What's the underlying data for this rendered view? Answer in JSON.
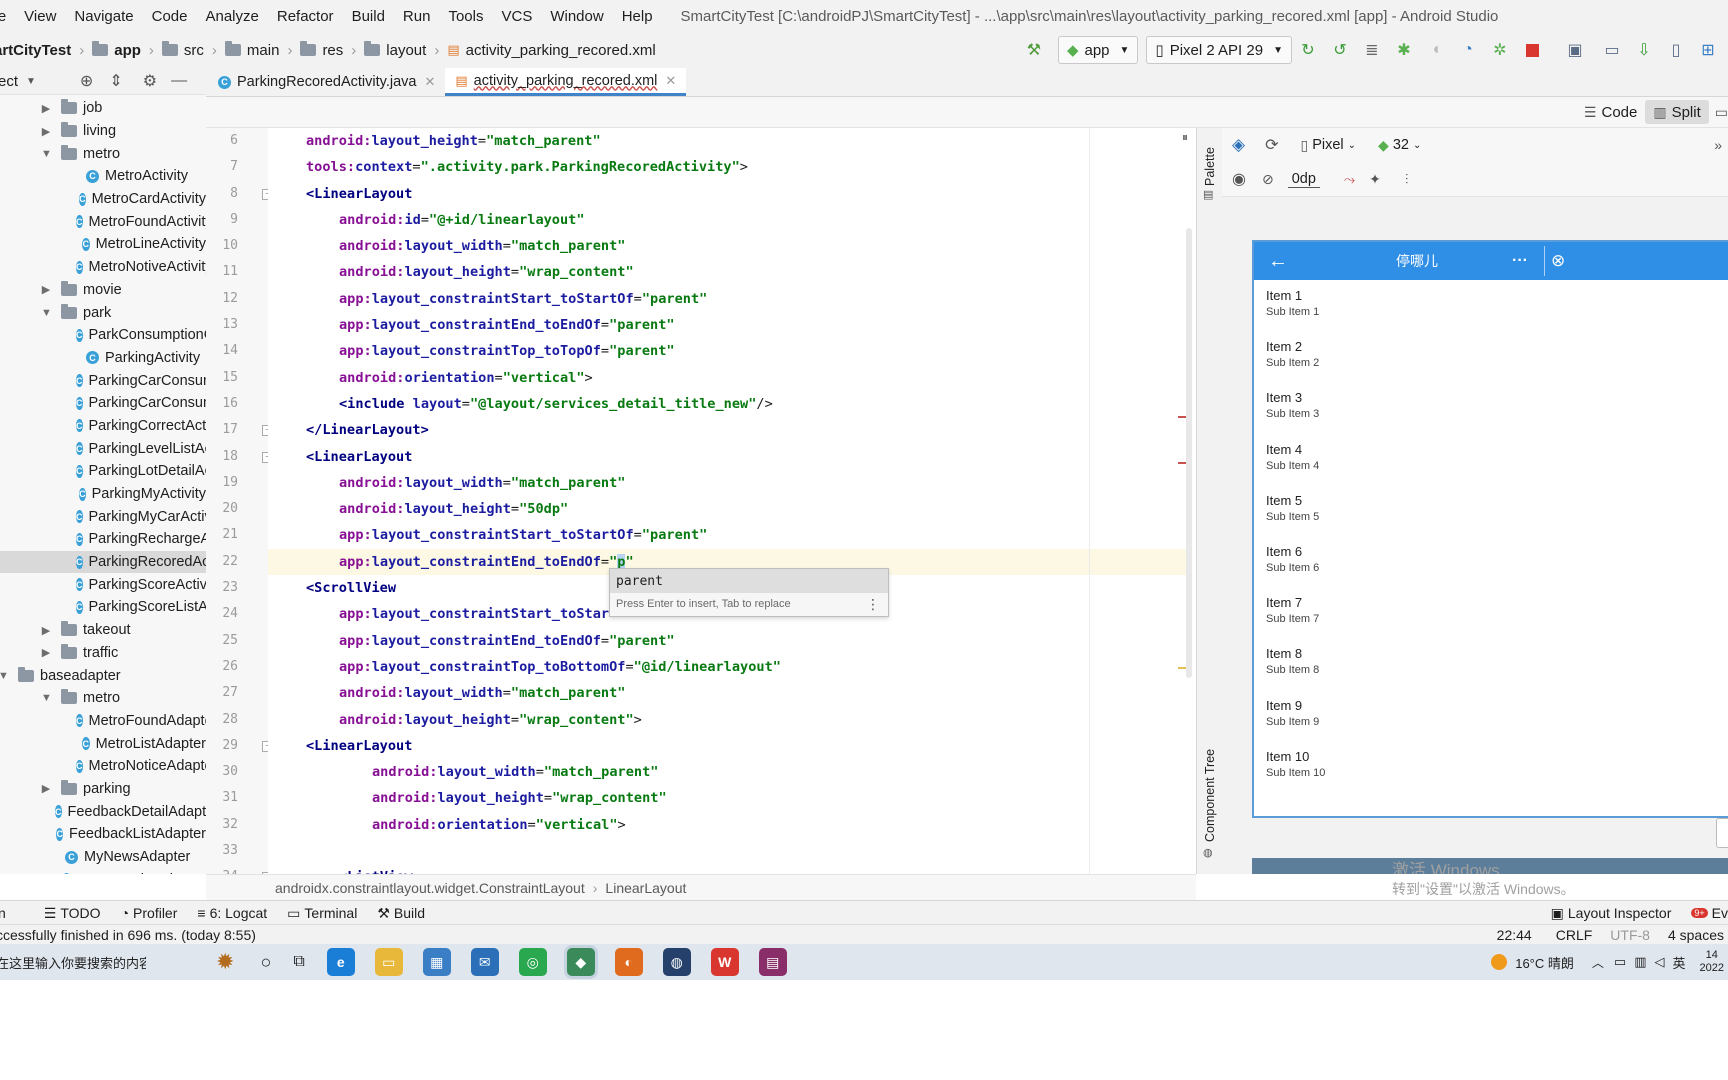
{
  "menubar": {
    "items": [
      "File",
      "View",
      "Navigate",
      "Code",
      "Analyze",
      "Refactor",
      "Build",
      "Run",
      "Tools",
      "VCS",
      "Window",
      "Help"
    ],
    "window_title": "SmartCityTest [C:\\androidPJ\\SmartCityTest] - ...\\app\\src\\main\\res\\layout\\activity_parking_recored.xml [app] - Android Studio"
  },
  "navbar": {
    "crumbs": [
      "artCityTest",
      "app",
      "src",
      "main",
      "res",
      "layout",
      "activity_parking_recored.xml"
    ],
    "run_config": "app",
    "device": "Pixel 2 API 29"
  },
  "project": {
    "header": "ect",
    "rows": [
      {
        "label": "job",
        "kind": "folder",
        "indent": 1,
        "arrow": "right"
      },
      {
        "label": "living",
        "kind": "folder",
        "indent": 1,
        "arrow": "right"
      },
      {
        "label": "metro",
        "kind": "folder",
        "indent": 1,
        "arrow": "down"
      },
      {
        "label": "MetroActivity",
        "kind": "class",
        "indent": 2
      },
      {
        "label": "MetroCardActivity",
        "kind": "class",
        "indent": 2
      },
      {
        "label": "MetroFoundActivity",
        "kind": "class",
        "indent": 2
      },
      {
        "label": "MetroLineActivity",
        "kind": "class",
        "indent": 2
      },
      {
        "label": "MetroNotiveActivity",
        "kind": "class",
        "indent": 2
      },
      {
        "label": "movie",
        "kind": "folder",
        "indent": 1,
        "arrow": "right"
      },
      {
        "label": "park",
        "kind": "folder",
        "indent": 1,
        "arrow": "down"
      },
      {
        "label": "ParkConsumptionCl",
        "kind": "class",
        "indent": 2
      },
      {
        "label": "ParkingActivity",
        "kind": "class",
        "indent": 2
      },
      {
        "label": "ParkingCarConsump",
        "kind": "class",
        "indent": 2
      },
      {
        "label": "ParkingCarConsump",
        "kind": "class",
        "indent": 2
      },
      {
        "label": "ParkingCorrectActiv",
        "kind": "class",
        "indent": 2
      },
      {
        "label": "ParkingLevelListActi",
        "kind": "class",
        "indent": 2
      },
      {
        "label": "ParkingLotDetailAct",
        "kind": "class",
        "indent": 2
      },
      {
        "label": "ParkingMyActivity",
        "kind": "class",
        "indent": 2
      },
      {
        "label": "ParkingMyCarActivi",
        "kind": "class",
        "indent": 2
      },
      {
        "label": "ParkingRechargeAc",
        "kind": "class",
        "indent": 2
      },
      {
        "label": "ParkingRecoredActi",
        "kind": "class",
        "indent": 2,
        "selected": true
      },
      {
        "label": "ParkingScoreActivit",
        "kind": "class",
        "indent": 2
      },
      {
        "label": "ParkingScoreListAct",
        "kind": "class",
        "indent": 2
      },
      {
        "label": "takeout",
        "kind": "folder",
        "indent": 1,
        "arrow": "right"
      },
      {
        "label": "traffic",
        "kind": "folder",
        "indent": 1,
        "arrow": "right"
      },
      {
        "label": "baseadapter",
        "kind": "folder",
        "indent": 0,
        "arrow": "down"
      },
      {
        "label": "metro",
        "kind": "folder",
        "indent": 1,
        "arrow": "down"
      },
      {
        "label": "MetroFoundAdapte",
        "kind": "class",
        "indent": 2
      },
      {
        "label": "MetroListAdapter",
        "kind": "class",
        "indent": 2
      },
      {
        "label": "MetroNoticeAdapte",
        "kind": "class",
        "indent": 2
      },
      {
        "label": "parking",
        "kind": "folder",
        "indent": 1,
        "arrow": "right"
      },
      {
        "label": "FeedbackDetailAdapter",
        "kind": "class",
        "indent": 1
      },
      {
        "label": "FeedbackListAdapter",
        "kind": "class",
        "indent": 1
      },
      {
        "label": "MyNewsAdapter",
        "kind": "class",
        "indent": 1
      },
      {
        "label": "MyNewsListAdapter",
        "kind": "class",
        "indent": 1
      }
    ]
  },
  "tabs": [
    {
      "label": "ParkingRecoredActivity.java",
      "active": false
    },
    {
      "label": "activity_parking_recored.xml",
      "active": true
    }
  ],
  "viewmodes": {
    "code": "Code",
    "split": "Split"
  },
  "editor": {
    "lines": [
      {
        "n": "6",
        "indent": 2,
        "parts": [
          [
            "ns",
            "android:"
          ],
          [
            "attr",
            "layout_height"
          ],
          [
            "p",
            "="
          ],
          [
            "str",
            "\"match_parent\""
          ]
        ]
      },
      {
        "n": "7",
        "indent": 2,
        "parts": [
          [
            "ns",
            "tools:"
          ],
          [
            "attr",
            "context"
          ],
          [
            "p",
            "="
          ],
          [
            "str",
            "\".activity.park.ParkingRecoredActivity\""
          ],
          [
            "p",
            ">"
          ]
        ]
      },
      {
        "n": "8",
        "indent": 2,
        "parts": [
          [
            "tag",
            "<LinearLayout"
          ]
        ]
      },
      {
        "n": "9",
        "indent": 4,
        "parts": [
          [
            "ns",
            "android:"
          ],
          [
            "attr",
            "id"
          ],
          [
            "p",
            "="
          ],
          [
            "str",
            "\"@+id/linearlayout\""
          ]
        ]
      },
      {
        "n": "10",
        "indent": 4,
        "parts": [
          [
            "ns",
            "android:"
          ],
          [
            "attr",
            "layout_width"
          ],
          [
            "p",
            "="
          ],
          [
            "str",
            "\"match_parent\""
          ]
        ]
      },
      {
        "n": "11",
        "indent": 4,
        "parts": [
          [
            "ns",
            "android:"
          ],
          [
            "attr",
            "layout_height"
          ],
          [
            "p",
            "="
          ],
          [
            "str",
            "\"wrap_content\""
          ]
        ]
      },
      {
        "n": "12",
        "indent": 4,
        "parts": [
          [
            "ns",
            "app:"
          ],
          [
            "attr",
            "layout_constraintStart_toStartOf"
          ],
          [
            "p",
            "="
          ],
          [
            "str",
            "\"parent\""
          ]
        ]
      },
      {
        "n": "13",
        "indent": 4,
        "parts": [
          [
            "ns",
            "app:"
          ],
          [
            "attr",
            "layout_constraintEnd_toEndOf"
          ],
          [
            "p",
            "="
          ],
          [
            "str",
            "\"parent\""
          ]
        ]
      },
      {
        "n": "14",
        "indent": 4,
        "parts": [
          [
            "ns",
            "app:"
          ],
          [
            "attr",
            "layout_constraintTop_toTopOf"
          ],
          [
            "p",
            "="
          ],
          [
            "str",
            "\"parent\""
          ]
        ]
      },
      {
        "n": "15",
        "indent": 4,
        "parts": [
          [
            "ns",
            "android:"
          ],
          [
            "attr",
            "orientation"
          ],
          [
            "p",
            "="
          ],
          [
            "str",
            "\"vertical\""
          ],
          [
            "p",
            ">"
          ]
        ]
      },
      {
        "n": "16",
        "indent": 4,
        "parts": [
          [
            "tag",
            "<include "
          ],
          [
            "attr",
            "layout"
          ],
          [
            "p",
            "="
          ],
          [
            "str",
            "\"@layout/services_detail_title_new\""
          ],
          [
            "p",
            "/>"
          ]
        ]
      },
      {
        "n": "17",
        "indent": 2,
        "parts": [
          [
            "tag",
            "</LinearLayout>"
          ]
        ]
      },
      {
        "n": "18",
        "indent": 2,
        "parts": [
          [
            "tag",
            "<LinearLayout"
          ]
        ]
      },
      {
        "n": "19",
        "indent": 4,
        "parts": [
          [
            "ns",
            "android:"
          ],
          [
            "attr",
            "layout_width"
          ],
          [
            "p",
            "="
          ],
          [
            "str",
            "\"match_parent\""
          ]
        ]
      },
      {
        "n": "20",
        "indent": 4,
        "parts": [
          [
            "ns",
            "android:"
          ],
          [
            "attr",
            "layout_height"
          ],
          [
            "p",
            "="
          ],
          [
            "str",
            "\"50dp\""
          ]
        ]
      },
      {
        "n": "21",
        "indent": 4,
        "parts": [
          [
            "ns",
            "app:"
          ],
          [
            "attr",
            "layout_constraintStart_toStartOf"
          ],
          [
            "p",
            "="
          ],
          [
            "str",
            "\"parent\""
          ]
        ]
      },
      {
        "n": "22",
        "indent": 4,
        "hl": true,
        "parts": [
          [
            "ns",
            "app:"
          ],
          [
            "attr",
            "layout_constraintEnd_toEndOf"
          ],
          [
            "p",
            "="
          ],
          [
            "str",
            "\""
          ],
          [
            "sel",
            "p"
          ],
          [
            "str",
            "\""
          ]
        ]
      },
      {
        "n": "23",
        "indent": 2,
        "parts": [
          [
            "tag",
            "<ScrollView"
          ]
        ]
      },
      {
        "n": "24",
        "indent": 4,
        "parts": [
          [
            "ns",
            "app:"
          ],
          [
            "attr",
            "layout_constraintStart_toStar"
          ]
        ]
      },
      {
        "n": "25",
        "indent": 4,
        "parts": [
          [
            "ns",
            "app:"
          ],
          [
            "attr",
            "layout_constraintEnd_toEndOf"
          ],
          [
            "p",
            "="
          ],
          [
            "str",
            "\"parent\""
          ]
        ]
      },
      {
        "n": "26",
        "indent": 4,
        "parts": [
          [
            "ns",
            "app:"
          ],
          [
            "attr",
            "layout_constraintTop_toBottomOf"
          ],
          [
            "p",
            "="
          ],
          [
            "str",
            "\"@id/linearlayout\""
          ]
        ]
      },
      {
        "n": "27",
        "indent": 4,
        "parts": [
          [
            "ns",
            "android:"
          ],
          [
            "attr",
            "layout_width"
          ],
          [
            "p",
            "="
          ],
          [
            "str",
            "\"match_parent\""
          ]
        ]
      },
      {
        "n": "28",
        "indent": 4,
        "parts": [
          [
            "ns",
            "android:"
          ],
          [
            "attr",
            "layout_height"
          ],
          [
            "p",
            "="
          ],
          [
            "str",
            "\"wrap_content\""
          ],
          [
            "p",
            ">"
          ]
        ]
      },
      {
        "n": "29",
        "indent": 2,
        "parts": [
          [
            "tag",
            "<LinearLayout"
          ]
        ]
      },
      {
        "n": "30",
        "indent": 6,
        "parts": [
          [
            "ns",
            "android:"
          ],
          [
            "attr",
            "layout_width"
          ],
          [
            "p",
            "="
          ],
          [
            "str",
            "\"match_parent\""
          ]
        ]
      },
      {
        "n": "31",
        "indent": 6,
        "parts": [
          [
            "ns",
            "android:"
          ],
          [
            "attr",
            "layout_height"
          ],
          [
            "p",
            "="
          ],
          [
            "str",
            "\"wrap_content\""
          ]
        ]
      },
      {
        "n": "32",
        "indent": 6,
        "parts": [
          [
            "ns",
            "android:"
          ],
          [
            "attr",
            "orientation"
          ],
          [
            "p",
            "="
          ],
          [
            "str",
            "\"vertical\""
          ],
          [
            "p",
            ">"
          ]
        ]
      },
      {
        "n": "33",
        "indent": 0,
        "parts": []
      },
      {
        "n": "34",
        "indent": 4,
        "parts": [
          [
            "tag",
            "<ListView"
          ]
        ]
      }
    ]
  },
  "completion": {
    "suggestion": "parent",
    "hint": "Press Enter to insert, Tab to replace"
  },
  "side_tabs": {
    "palette": "Palette",
    "component_tree": "Component Tree"
  },
  "preview": {
    "device": "Pixel",
    "api": "32",
    "margin": "0dp",
    "appbar_title": "停哪儿",
    "items": [
      {
        "title": "Item 1",
        "sub": "Sub Item 1"
      },
      {
        "title": "Item 2",
        "sub": "Sub Item 2"
      },
      {
        "title": "Item 3",
        "sub": "Sub Item 3"
      },
      {
        "title": "Item 4",
        "sub": "Sub Item 4"
      },
      {
        "title": "Item 5",
        "sub": "Sub Item 5"
      },
      {
        "title": "Item 6",
        "sub": "Sub Item 6"
      },
      {
        "title": "Item 7",
        "sub": "Sub Item 7"
      },
      {
        "title": "Item 8",
        "sub": "Sub Item 8"
      },
      {
        "title": "Item 9",
        "sub": "Sub Item 9"
      },
      {
        "title": "Item 10",
        "sub": "Sub Item 10"
      }
    ],
    "watermark_1": "激活 Windows",
    "watermark_2": "转到\"设置\"以激活 Windows。"
  },
  "structure": {
    "path": [
      "androidx.constraintlayout.widget.ConstraintLayout",
      "LinearLayout"
    ]
  },
  "toolwindows": {
    "run": "n",
    "todo": "TODO",
    "profiler": "Profiler",
    "logcat": "6: Logcat",
    "terminal": "Terminal",
    "build": "Build",
    "layout_inspector": "Layout Inspector",
    "event_log": "Ev"
  },
  "status": {
    "message": "ccessfully finished in 696 ms. (today 8:55)",
    "position": "22:44",
    "line_sep": "CRLF",
    "encoding": "UTF-8",
    "indent": "4 spaces"
  },
  "taskbar": {
    "search_placeholder": "在这里输入你要搜索的内容",
    "weather": "16°C 晴朗",
    "ime": "英",
    "time": "14",
    "date": "2022"
  }
}
